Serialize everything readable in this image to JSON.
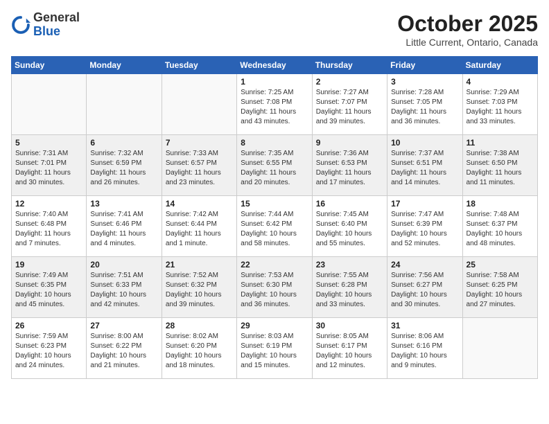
{
  "header": {
    "logo_line1": "General",
    "logo_line2": "Blue",
    "month": "October 2025",
    "location": "Little Current, Ontario, Canada"
  },
  "weekdays": [
    "Sunday",
    "Monday",
    "Tuesday",
    "Wednesday",
    "Thursday",
    "Friday",
    "Saturday"
  ],
  "weeks": [
    [
      {
        "day": "",
        "info": ""
      },
      {
        "day": "",
        "info": ""
      },
      {
        "day": "",
        "info": ""
      },
      {
        "day": "1",
        "info": "Sunrise: 7:25 AM\nSunset: 7:08 PM\nDaylight: 11 hours\nand 43 minutes."
      },
      {
        "day": "2",
        "info": "Sunrise: 7:27 AM\nSunset: 7:07 PM\nDaylight: 11 hours\nand 39 minutes."
      },
      {
        "day": "3",
        "info": "Sunrise: 7:28 AM\nSunset: 7:05 PM\nDaylight: 11 hours\nand 36 minutes."
      },
      {
        "day": "4",
        "info": "Sunrise: 7:29 AM\nSunset: 7:03 PM\nDaylight: 11 hours\nand 33 minutes."
      }
    ],
    [
      {
        "day": "5",
        "info": "Sunrise: 7:31 AM\nSunset: 7:01 PM\nDaylight: 11 hours\nand 30 minutes."
      },
      {
        "day": "6",
        "info": "Sunrise: 7:32 AM\nSunset: 6:59 PM\nDaylight: 11 hours\nand 26 minutes."
      },
      {
        "day": "7",
        "info": "Sunrise: 7:33 AM\nSunset: 6:57 PM\nDaylight: 11 hours\nand 23 minutes."
      },
      {
        "day": "8",
        "info": "Sunrise: 7:35 AM\nSunset: 6:55 PM\nDaylight: 11 hours\nand 20 minutes."
      },
      {
        "day": "9",
        "info": "Sunrise: 7:36 AM\nSunset: 6:53 PM\nDaylight: 11 hours\nand 17 minutes."
      },
      {
        "day": "10",
        "info": "Sunrise: 7:37 AM\nSunset: 6:51 PM\nDaylight: 11 hours\nand 14 minutes."
      },
      {
        "day": "11",
        "info": "Sunrise: 7:38 AM\nSunset: 6:50 PM\nDaylight: 11 hours\nand 11 minutes."
      }
    ],
    [
      {
        "day": "12",
        "info": "Sunrise: 7:40 AM\nSunset: 6:48 PM\nDaylight: 11 hours\nand 7 minutes."
      },
      {
        "day": "13",
        "info": "Sunrise: 7:41 AM\nSunset: 6:46 PM\nDaylight: 11 hours\nand 4 minutes."
      },
      {
        "day": "14",
        "info": "Sunrise: 7:42 AM\nSunset: 6:44 PM\nDaylight: 11 hours\nand 1 minute."
      },
      {
        "day": "15",
        "info": "Sunrise: 7:44 AM\nSunset: 6:42 PM\nDaylight: 10 hours\nand 58 minutes."
      },
      {
        "day": "16",
        "info": "Sunrise: 7:45 AM\nSunset: 6:40 PM\nDaylight: 10 hours\nand 55 minutes."
      },
      {
        "day": "17",
        "info": "Sunrise: 7:47 AM\nSunset: 6:39 PM\nDaylight: 10 hours\nand 52 minutes."
      },
      {
        "day": "18",
        "info": "Sunrise: 7:48 AM\nSunset: 6:37 PM\nDaylight: 10 hours\nand 48 minutes."
      }
    ],
    [
      {
        "day": "19",
        "info": "Sunrise: 7:49 AM\nSunset: 6:35 PM\nDaylight: 10 hours\nand 45 minutes."
      },
      {
        "day": "20",
        "info": "Sunrise: 7:51 AM\nSunset: 6:33 PM\nDaylight: 10 hours\nand 42 minutes."
      },
      {
        "day": "21",
        "info": "Sunrise: 7:52 AM\nSunset: 6:32 PM\nDaylight: 10 hours\nand 39 minutes."
      },
      {
        "day": "22",
        "info": "Sunrise: 7:53 AM\nSunset: 6:30 PM\nDaylight: 10 hours\nand 36 minutes."
      },
      {
        "day": "23",
        "info": "Sunrise: 7:55 AM\nSunset: 6:28 PM\nDaylight: 10 hours\nand 33 minutes."
      },
      {
        "day": "24",
        "info": "Sunrise: 7:56 AM\nSunset: 6:27 PM\nDaylight: 10 hours\nand 30 minutes."
      },
      {
        "day": "25",
        "info": "Sunrise: 7:58 AM\nSunset: 6:25 PM\nDaylight: 10 hours\nand 27 minutes."
      }
    ],
    [
      {
        "day": "26",
        "info": "Sunrise: 7:59 AM\nSunset: 6:23 PM\nDaylight: 10 hours\nand 24 minutes."
      },
      {
        "day": "27",
        "info": "Sunrise: 8:00 AM\nSunset: 6:22 PM\nDaylight: 10 hours\nand 21 minutes."
      },
      {
        "day": "28",
        "info": "Sunrise: 8:02 AM\nSunset: 6:20 PM\nDaylight: 10 hours\nand 18 minutes."
      },
      {
        "day": "29",
        "info": "Sunrise: 8:03 AM\nSunset: 6:19 PM\nDaylight: 10 hours\nand 15 minutes."
      },
      {
        "day": "30",
        "info": "Sunrise: 8:05 AM\nSunset: 6:17 PM\nDaylight: 10 hours\nand 12 minutes."
      },
      {
        "day": "31",
        "info": "Sunrise: 8:06 AM\nSunset: 6:16 PM\nDaylight: 10 hours\nand 9 minutes."
      },
      {
        "day": "",
        "info": ""
      }
    ]
  ]
}
